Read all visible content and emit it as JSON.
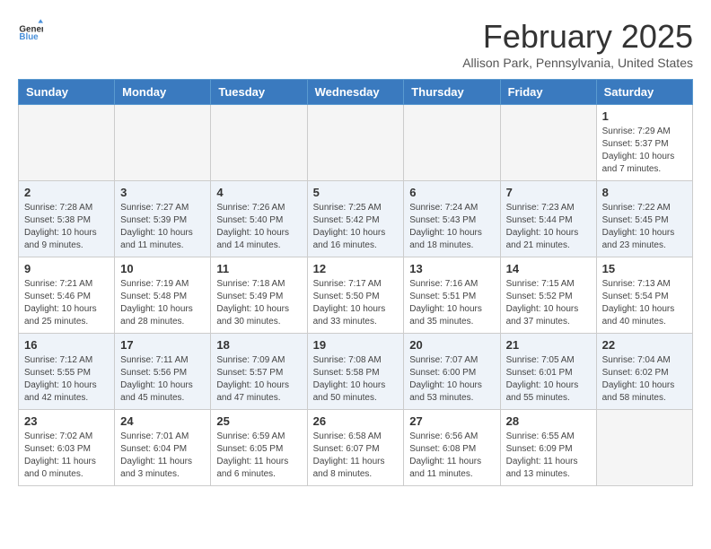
{
  "logo": {
    "general": "General",
    "blue": "Blue"
  },
  "title": "February 2025",
  "location": "Allison Park, Pennsylvania, United States",
  "weekdays": [
    "Sunday",
    "Monday",
    "Tuesday",
    "Wednesday",
    "Thursday",
    "Friday",
    "Saturday"
  ],
  "weeks": [
    [
      {
        "day": "",
        "info": ""
      },
      {
        "day": "",
        "info": ""
      },
      {
        "day": "",
        "info": ""
      },
      {
        "day": "",
        "info": ""
      },
      {
        "day": "",
        "info": ""
      },
      {
        "day": "",
        "info": ""
      },
      {
        "day": "1",
        "info": "Sunrise: 7:29 AM\nSunset: 5:37 PM\nDaylight: 10 hours and 7 minutes."
      }
    ],
    [
      {
        "day": "2",
        "info": "Sunrise: 7:28 AM\nSunset: 5:38 PM\nDaylight: 10 hours and 9 minutes."
      },
      {
        "day": "3",
        "info": "Sunrise: 7:27 AM\nSunset: 5:39 PM\nDaylight: 10 hours and 11 minutes."
      },
      {
        "day": "4",
        "info": "Sunrise: 7:26 AM\nSunset: 5:40 PM\nDaylight: 10 hours and 14 minutes."
      },
      {
        "day": "5",
        "info": "Sunrise: 7:25 AM\nSunset: 5:42 PM\nDaylight: 10 hours and 16 minutes."
      },
      {
        "day": "6",
        "info": "Sunrise: 7:24 AM\nSunset: 5:43 PM\nDaylight: 10 hours and 18 minutes."
      },
      {
        "day": "7",
        "info": "Sunrise: 7:23 AM\nSunset: 5:44 PM\nDaylight: 10 hours and 21 minutes."
      },
      {
        "day": "8",
        "info": "Sunrise: 7:22 AM\nSunset: 5:45 PM\nDaylight: 10 hours and 23 minutes."
      }
    ],
    [
      {
        "day": "9",
        "info": "Sunrise: 7:21 AM\nSunset: 5:46 PM\nDaylight: 10 hours and 25 minutes."
      },
      {
        "day": "10",
        "info": "Sunrise: 7:19 AM\nSunset: 5:48 PM\nDaylight: 10 hours and 28 minutes."
      },
      {
        "day": "11",
        "info": "Sunrise: 7:18 AM\nSunset: 5:49 PM\nDaylight: 10 hours and 30 minutes."
      },
      {
        "day": "12",
        "info": "Sunrise: 7:17 AM\nSunset: 5:50 PM\nDaylight: 10 hours and 33 minutes."
      },
      {
        "day": "13",
        "info": "Sunrise: 7:16 AM\nSunset: 5:51 PM\nDaylight: 10 hours and 35 minutes."
      },
      {
        "day": "14",
        "info": "Sunrise: 7:15 AM\nSunset: 5:52 PM\nDaylight: 10 hours and 37 minutes."
      },
      {
        "day": "15",
        "info": "Sunrise: 7:13 AM\nSunset: 5:54 PM\nDaylight: 10 hours and 40 minutes."
      }
    ],
    [
      {
        "day": "16",
        "info": "Sunrise: 7:12 AM\nSunset: 5:55 PM\nDaylight: 10 hours and 42 minutes."
      },
      {
        "day": "17",
        "info": "Sunrise: 7:11 AM\nSunset: 5:56 PM\nDaylight: 10 hours and 45 minutes."
      },
      {
        "day": "18",
        "info": "Sunrise: 7:09 AM\nSunset: 5:57 PM\nDaylight: 10 hours and 47 minutes."
      },
      {
        "day": "19",
        "info": "Sunrise: 7:08 AM\nSunset: 5:58 PM\nDaylight: 10 hours and 50 minutes."
      },
      {
        "day": "20",
        "info": "Sunrise: 7:07 AM\nSunset: 6:00 PM\nDaylight: 10 hours and 53 minutes."
      },
      {
        "day": "21",
        "info": "Sunrise: 7:05 AM\nSunset: 6:01 PM\nDaylight: 10 hours and 55 minutes."
      },
      {
        "day": "22",
        "info": "Sunrise: 7:04 AM\nSunset: 6:02 PM\nDaylight: 10 hours and 58 minutes."
      }
    ],
    [
      {
        "day": "23",
        "info": "Sunrise: 7:02 AM\nSunset: 6:03 PM\nDaylight: 11 hours and 0 minutes."
      },
      {
        "day": "24",
        "info": "Sunrise: 7:01 AM\nSunset: 6:04 PM\nDaylight: 11 hours and 3 minutes."
      },
      {
        "day": "25",
        "info": "Sunrise: 6:59 AM\nSunset: 6:05 PM\nDaylight: 11 hours and 6 minutes."
      },
      {
        "day": "26",
        "info": "Sunrise: 6:58 AM\nSunset: 6:07 PM\nDaylight: 11 hours and 8 minutes."
      },
      {
        "day": "27",
        "info": "Sunrise: 6:56 AM\nSunset: 6:08 PM\nDaylight: 11 hours and 11 minutes."
      },
      {
        "day": "28",
        "info": "Sunrise: 6:55 AM\nSunset: 6:09 PM\nDaylight: 11 hours and 13 minutes."
      },
      {
        "day": "",
        "info": ""
      }
    ]
  ]
}
